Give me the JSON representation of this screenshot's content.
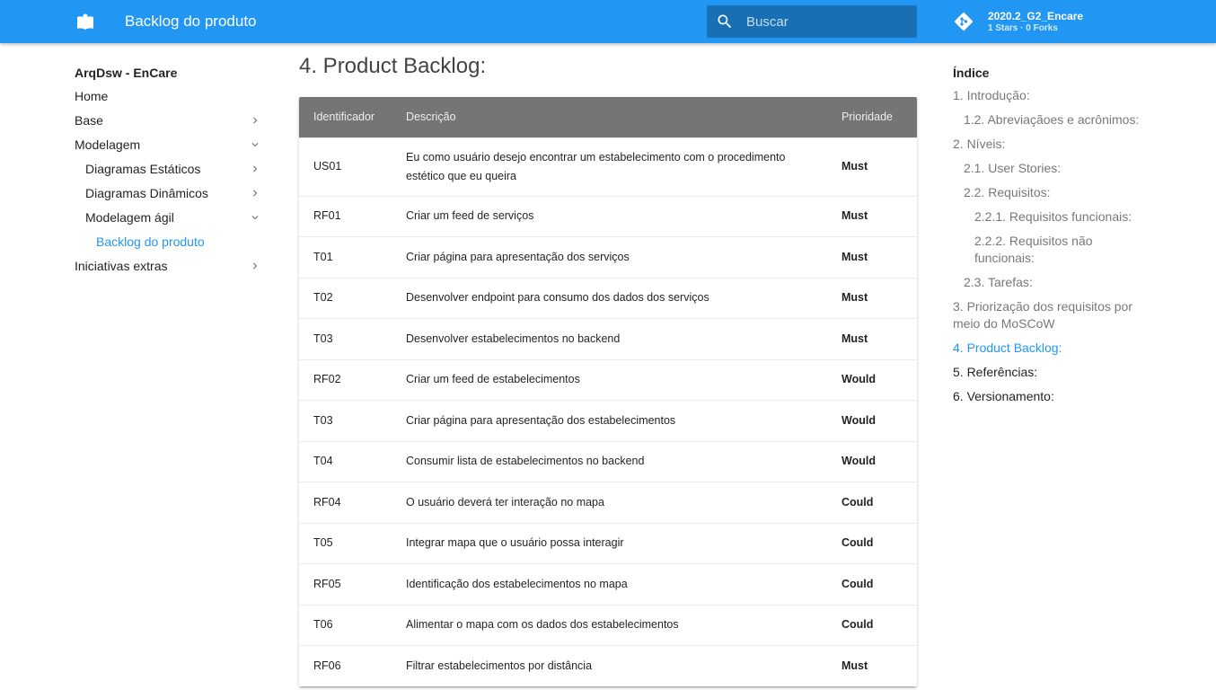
{
  "header": {
    "site_title": "Backlog do produto",
    "search_placeholder": "Buscar",
    "repo_name": "2020.2_G2_Encare",
    "repo_facts": "1 Stars · 0 Forks"
  },
  "nav": {
    "title": "ArqDsw - EnCare",
    "items": [
      {
        "label": "Home",
        "level": 1,
        "chevron": "none"
      },
      {
        "label": "Base",
        "level": 1,
        "chevron": "right"
      },
      {
        "label": "Modelagem",
        "level": 1,
        "chevron": "down"
      },
      {
        "label": "Diagramas Estáticos",
        "level": 2,
        "chevron": "right"
      },
      {
        "label": "Diagramas Dinâmicos",
        "level": 2,
        "chevron": "right"
      },
      {
        "label": "Modelagem ágil",
        "level": 2,
        "chevron": "down"
      },
      {
        "label": "Backlog do produto",
        "level": 3,
        "chevron": "none",
        "active": true
      },
      {
        "label": "Iniciativas extras",
        "level": 1,
        "chevron": "right"
      }
    ]
  },
  "main": {
    "heading": "4. Product Backlog:",
    "table": {
      "headers": [
        "Identificador",
        "Descrição",
        "Prioridade"
      ],
      "rows": [
        {
          "id": "US01",
          "desc": "Eu como usuário desejo encontrar um estabelecimento com o procedimento estético que eu queira",
          "prio": "Must"
        },
        {
          "id": "RF01",
          "desc": "Criar um feed de serviços",
          "prio": "Must"
        },
        {
          "id": "T01",
          "desc": "Criar página para apresentação dos serviços",
          "prio": "Must"
        },
        {
          "id": "T02",
          "desc": "Desenvolver endpoint para consumo dos dados dos serviços",
          "prio": "Must"
        },
        {
          "id": "T03",
          "desc": "Desenvolver estabelecimentos no backend",
          "prio": "Must"
        },
        {
          "id": "RF02",
          "desc": "Criar um feed de estabelecimentos",
          "prio": "Would"
        },
        {
          "id": "T03",
          "desc": "Criar página para apresentação dos estabelecimentos",
          "prio": "Would"
        },
        {
          "id": "T04",
          "desc": "Consumir lista de estabelecimentos no backend",
          "prio": "Would"
        },
        {
          "id": "RF04",
          "desc": "O usuário deverá ter interação no mapa",
          "prio": "Could"
        },
        {
          "id": "T05",
          "desc": "Integrar mapa que o usuário possa interagir",
          "prio": "Could"
        },
        {
          "id": "RF05",
          "desc": "Identificação dos estabelecimentos no mapa",
          "prio": "Could"
        },
        {
          "id": "T06",
          "desc": "Alimentar o mapa com os dados dos estabelecimentos",
          "prio": "Could"
        },
        {
          "id": "RF06",
          "desc": "Filtrar estabelecimentos por distância",
          "prio": "Must"
        }
      ]
    }
  },
  "toc": {
    "title": "Índice",
    "items": [
      {
        "label": "1. Introdução:",
        "level": 1
      },
      {
        "label": "1.2. Abreviaçãoes e acrônimos:",
        "level": 2
      },
      {
        "label": "2. Níveis:",
        "level": 1
      },
      {
        "label": "2.1. User Stories:",
        "level": 2
      },
      {
        "label": "2.2. Requisitos:",
        "level": 2
      },
      {
        "label": "2.2.1. Requisitos funcionais:",
        "level": 3
      },
      {
        "label": "2.2.2. Requisitos não funcionais:",
        "level": 3
      },
      {
        "label": "2.3. Tarefas:",
        "level": 2
      },
      {
        "label": "3. Priorização dos requisitos por meio do MoSCoW",
        "level": 1
      },
      {
        "label": "4. Product Backlog:",
        "level": 1,
        "active": true
      },
      {
        "label": "5. Referências:",
        "level": 1,
        "plain": true
      },
      {
        "label": "6. Versionamento:",
        "level": 1,
        "plain": true
      }
    ]
  },
  "colors": {
    "primary": "#2196f3",
    "table_header": "#757575"
  }
}
